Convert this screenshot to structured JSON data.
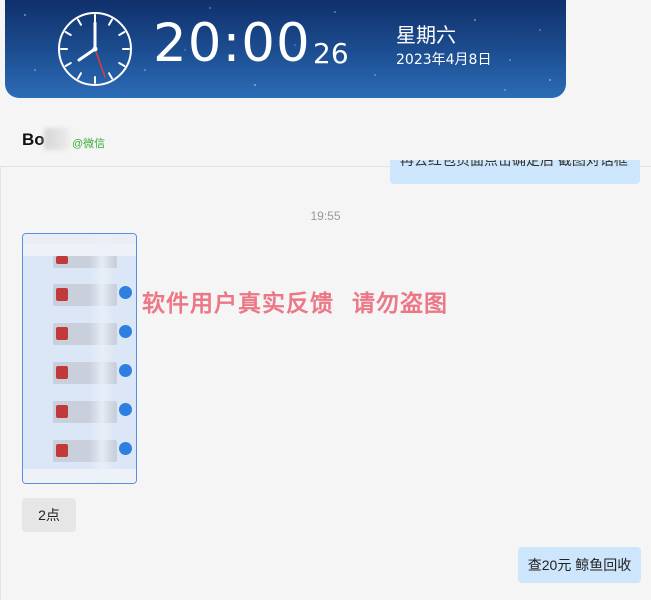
{
  "clock_widget": {
    "time": "20:00",
    "seconds": "26",
    "weekday": "星期六",
    "date": "2023年4月8日"
  },
  "chat": {
    "contact_name": "Bo",
    "contact_source": "@微信",
    "messages": [
      {
        "direction": "out",
        "type": "text",
        "text": "再去红包页面点击确定后  截图对话框",
        "partial": true
      },
      {
        "type": "timestamp",
        "text": "19:55"
      },
      {
        "direction": "in",
        "type": "image"
      },
      {
        "direction": "in",
        "type": "text",
        "text": "2点"
      },
      {
        "direction": "out",
        "type": "text",
        "text": "查20元 鲸鱼回收"
      }
    ]
  },
  "watermark": "软件用户真实反馈  请勿盗图",
  "colors": {
    "banner_top": "#10306b",
    "banner_bottom": "#2c6cb6",
    "out_bubble": "#cde6fb",
    "in_bubble": "#e6e6e6",
    "watermark": "#ec6e7e",
    "source_tag": "#3bab3b"
  }
}
